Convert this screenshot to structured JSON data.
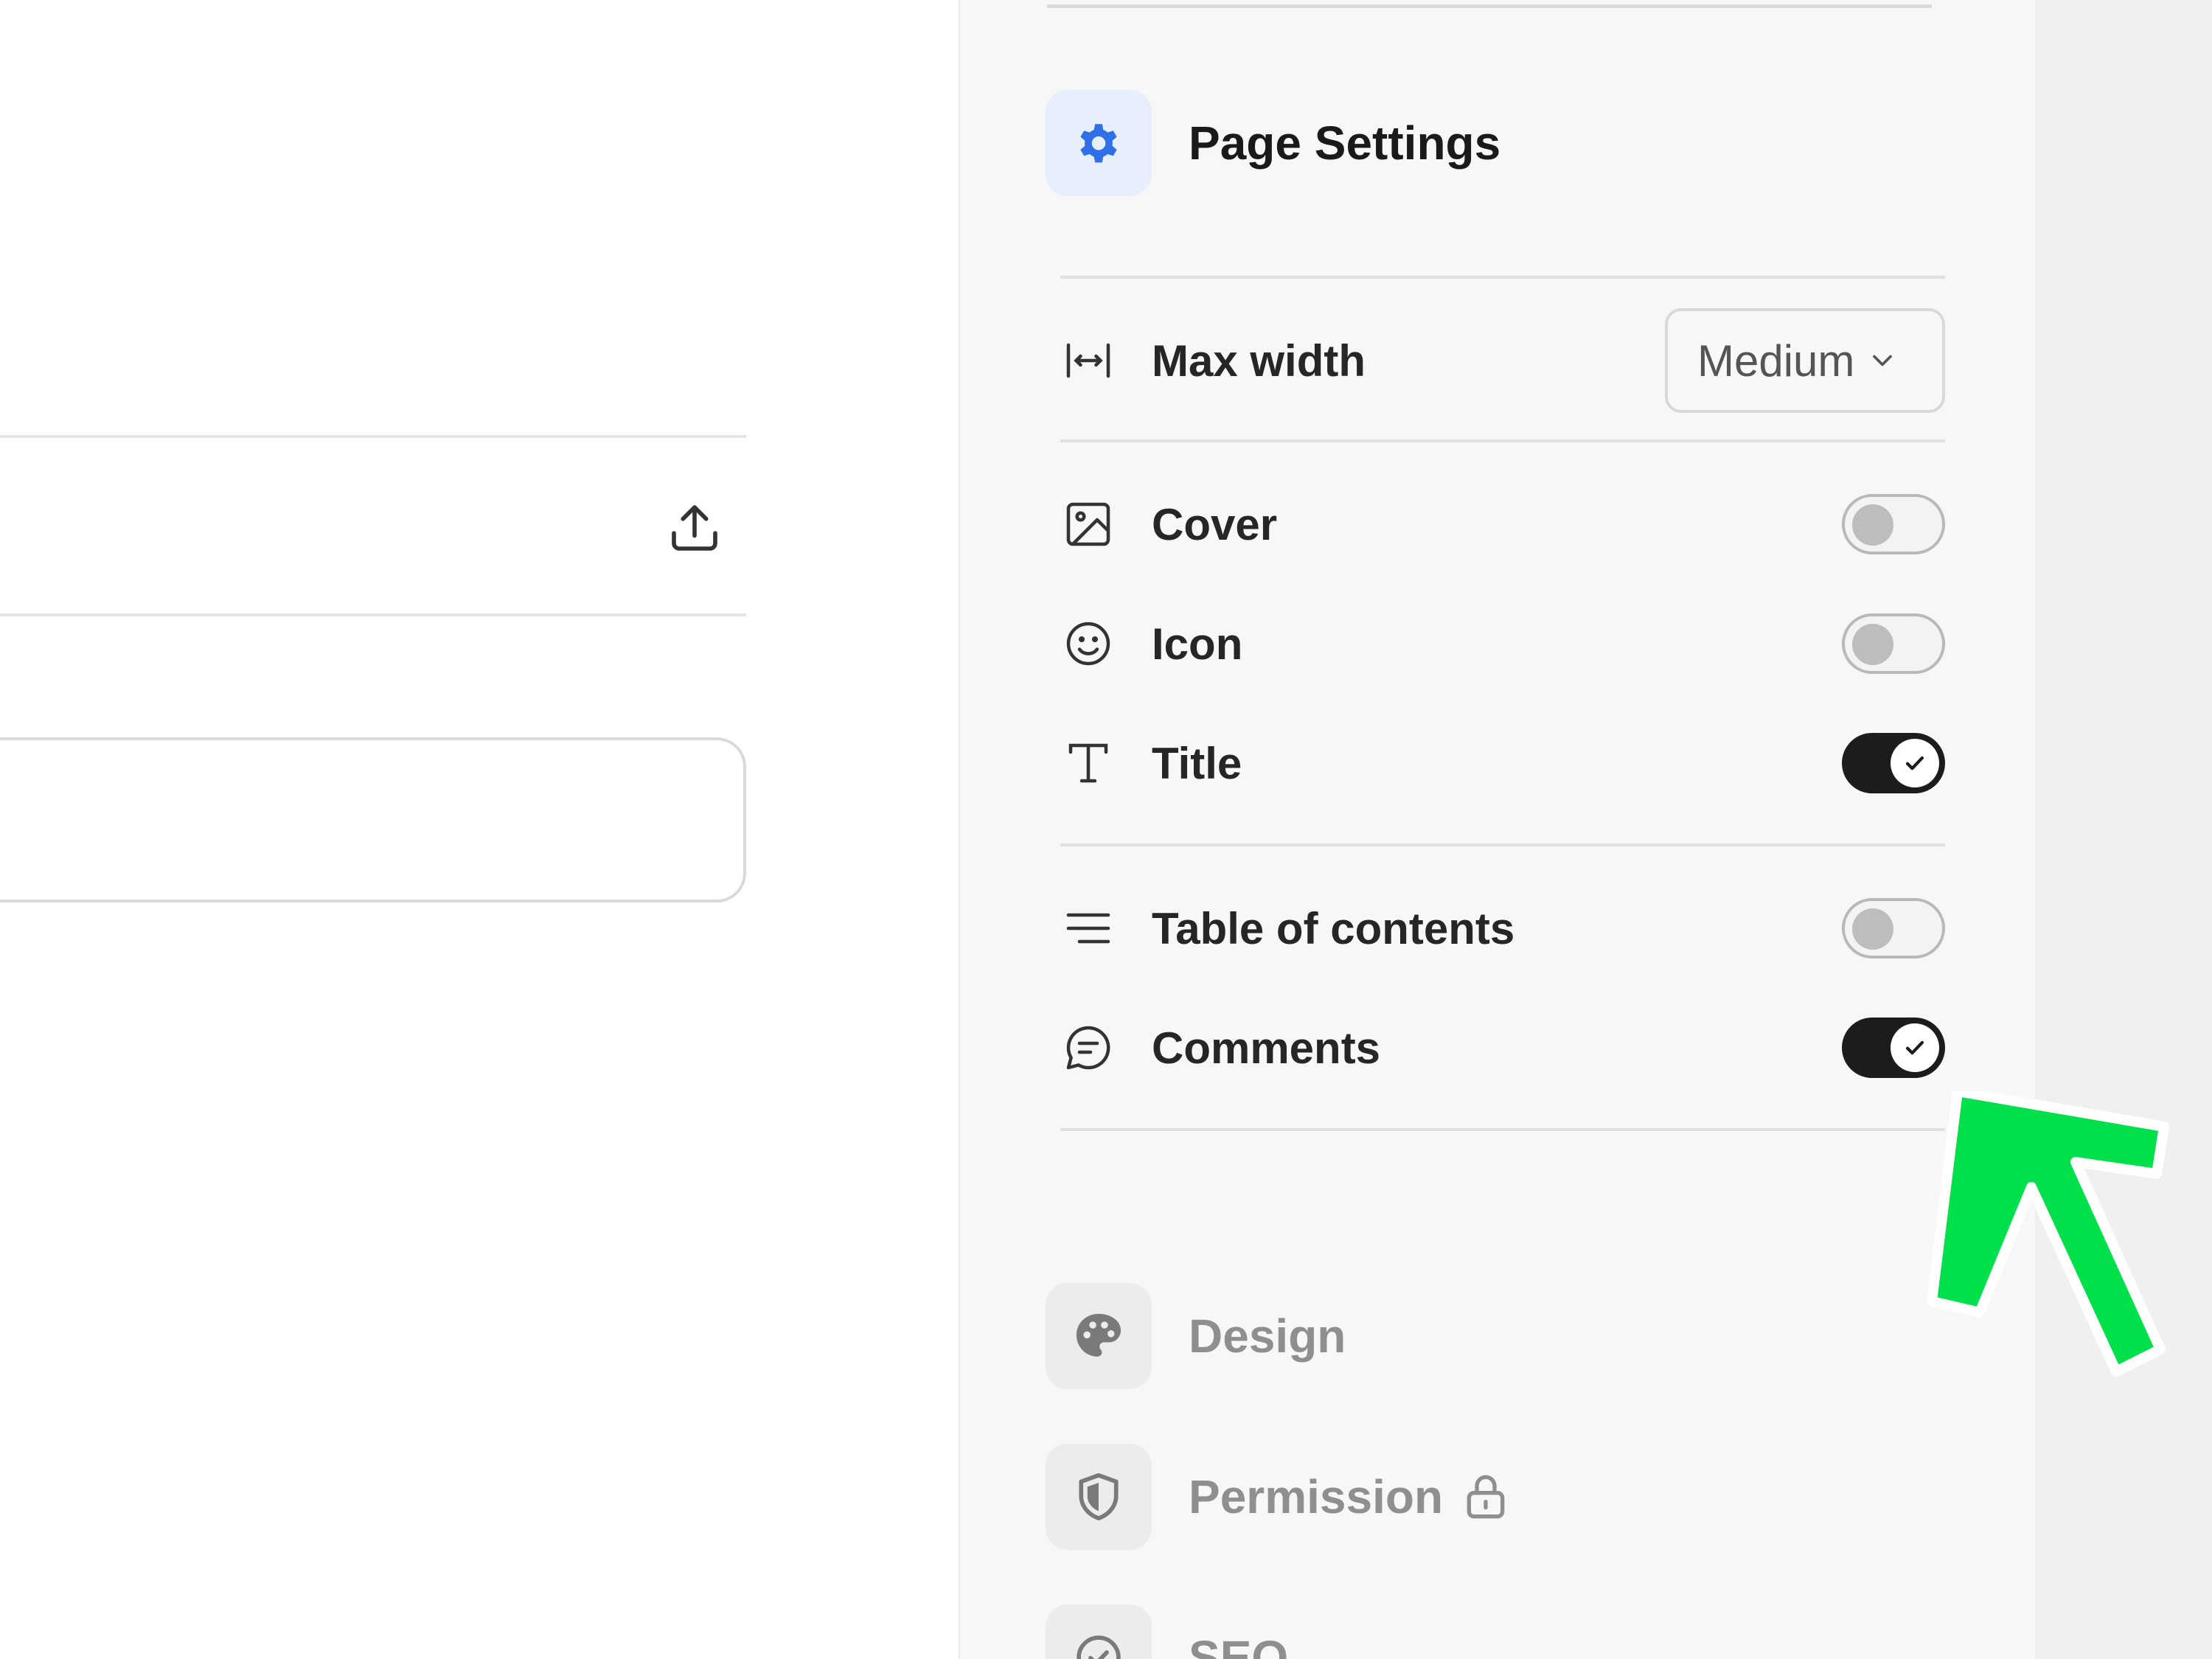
{
  "panel": {
    "title": "Page Settings",
    "rows": {
      "max_width": {
        "label": "Max width",
        "value": "Medium"
      },
      "cover": {
        "label": "Cover",
        "enabled": false
      },
      "icon": {
        "label": "Icon",
        "enabled": false
      },
      "title": {
        "label": "Title",
        "enabled": true
      },
      "toc": {
        "label": "Table of contents",
        "enabled": false
      },
      "comments": {
        "label": "Comments",
        "enabled": true
      }
    },
    "nav": {
      "design": "Design",
      "permission": "Permission",
      "seo": "SEO"
    }
  },
  "colors": {
    "accent": "#2f6fe8",
    "toggle_on": "#1c1c1c",
    "annotation_arrow": "#00e04b"
  },
  "icons": [
    "upload-icon",
    "gear-icon",
    "max-width-icon",
    "chevron-down-icon",
    "image-icon",
    "smiley-icon",
    "text-icon",
    "list-icon",
    "comment-icon",
    "check-icon",
    "palette-icon",
    "shield-icon",
    "lock-icon",
    "seo-icon"
  ]
}
